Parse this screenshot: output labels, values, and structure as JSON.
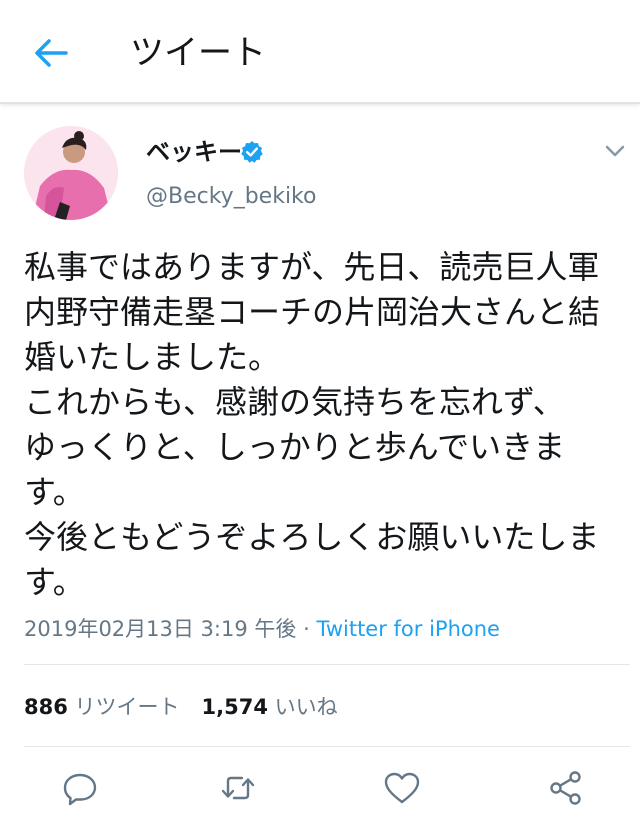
{
  "header": {
    "title": "ツイート"
  },
  "tweet": {
    "display_name": "ベッキー",
    "handle": "@Becky_bekiko",
    "text_lines": [
      "私事ではありますが、先日、読売巨人軍",
      "内野守備走塁コーチの片岡治大さんと結",
      "婚いたしました。",
      "これからも、感謝の気持ちを忘れず、",
      "ゆっくりと、しっかりと歩んでいきま",
      "す。",
      "今後ともどうぞよろしくお願いいたしま",
      "す。"
    ],
    "timestamp": "2019年02月13日 3:19 午後",
    "separator": "·",
    "source": "Twitter for iPhone"
  },
  "stats": {
    "retweets_count": "886",
    "retweets_label": "リツイート",
    "likes_count": "1,574",
    "likes_label": "いいね"
  },
  "colors": {
    "accent": "#1da1f2",
    "secondary_text": "#657786",
    "divider": "#e1e8ed",
    "icon_gray": "#657786"
  },
  "icons": {
    "back": "arrow-left-icon",
    "verified": "verified-badge-icon",
    "caret": "chevron-down-icon",
    "reply": "reply-icon",
    "retweet": "retweet-icon",
    "like": "heart-icon",
    "share": "share-icon"
  }
}
